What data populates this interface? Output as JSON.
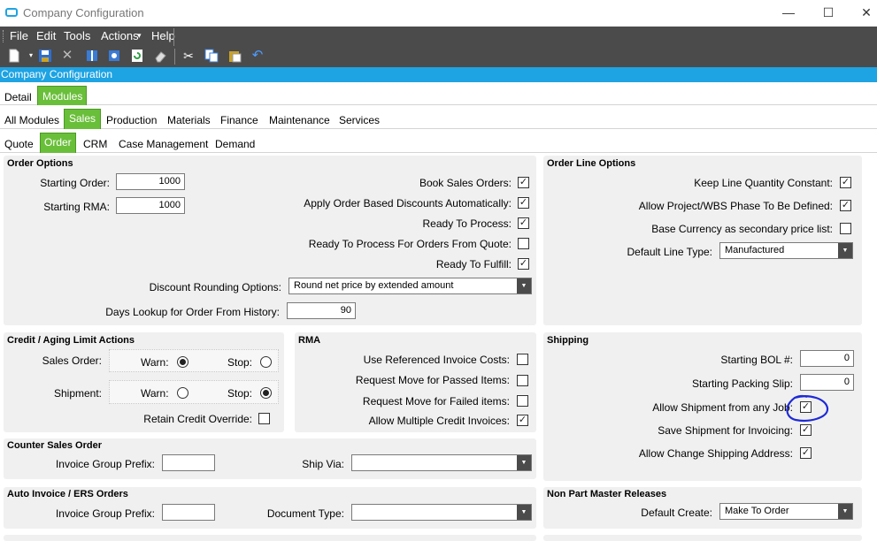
{
  "window": {
    "title": "Company Configuration",
    "minimize": "—",
    "maximize": "☐",
    "close": "✕"
  },
  "menu": [
    "File",
    "Edit",
    "Tools",
    "Actions",
    "Help"
  ],
  "actions_arrow": "▾",
  "form_title": "Company Configuration",
  "tabs_level1": [
    "Detail",
    "Modules"
  ],
  "tabs_level2": [
    "All Modules",
    "Sales",
    "Production",
    "Materials",
    "Finance",
    "Maintenance",
    "Services"
  ],
  "tabs_level3": [
    "Quote",
    "Order",
    "CRM",
    "Case Management",
    "Demand"
  ],
  "order_options": {
    "title": "Order Options",
    "starting_order_label": "Starting Order:",
    "starting_order_value": "1000",
    "starting_rma_label": "Starting RMA:",
    "starting_rma_value": "1000",
    "book_sales_orders": "Book Sales Orders:",
    "apply_discounts": "Apply Order Based Discounts Automatically:",
    "ready_to_process": "Ready To Process:",
    "ready_to_process_quote": "Ready To Process For Orders From Quote:",
    "ready_to_fulfill": "Ready To Fulfill:",
    "discount_rounding_label": "Discount Rounding Options:",
    "discount_rounding_value": "Round net price by extended amount",
    "days_lookup_label": "Days Lookup for Order From History:",
    "days_lookup_value": "90"
  },
  "order_line_options": {
    "title": "Order Line Options",
    "keep_line_qty": "Keep Line Quantity Constant:",
    "allow_project": "Allow Project/WBS Phase To Be Defined:",
    "base_currency": "Base Currency as secondary price list:",
    "default_line_type_label": "Default Line Type:",
    "default_line_type_value": "Manufactured"
  },
  "credit": {
    "title": "Credit / Aging Limit Actions",
    "sales_order": "Sales Order:",
    "shipment": "Shipment:",
    "warn": "Warn:",
    "stop": "Stop:",
    "retain_override": "Retain Credit Override:"
  },
  "rma": {
    "title": "RMA",
    "use_ref_costs": "Use Referenced Invoice Costs:",
    "move_passed": "Request Move for Passed Items:",
    "move_failed": "Request Move for Failed items:",
    "multiple_credit": "Allow Multiple Credit Invoices:"
  },
  "shipping": {
    "title": "Shipping",
    "starting_bol_label": "Starting BOL #:",
    "starting_bol_value": "0",
    "starting_packing_label": "Starting Packing Slip:",
    "starting_packing_value": "0",
    "allow_any_job": "Allow Shipment from any Job:",
    "save_for_invoicing": "Save Shipment for Invoicing:",
    "allow_change_address": "Allow Change Shipping Address:"
  },
  "counter_sales": {
    "title": "Counter Sales Order",
    "invoice_group_label": "Invoice Group Prefix:",
    "invoice_group_value": "",
    "ship_via_label": "Ship Via:",
    "ship_via_value": ""
  },
  "auto_invoice": {
    "title": "Auto Invoice / ERS Orders",
    "invoice_group_label": "Invoice Group Prefix:",
    "invoice_group_value": "",
    "document_type_label": "Document Type:",
    "document_type_value": ""
  },
  "non_part": {
    "title": "Non Part Master Releases",
    "default_create_label": "Default Create:",
    "default_create_value": "Make To Order"
  },
  "colors": {
    "accent_blue": "#1ea3e3",
    "active_tab_green": "#6abf3a",
    "menubar": "#4b4b4b",
    "annotation": "#1e2ad6"
  },
  "glyphs": {
    "check": "✓",
    "dropdown": "▼"
  }
}
